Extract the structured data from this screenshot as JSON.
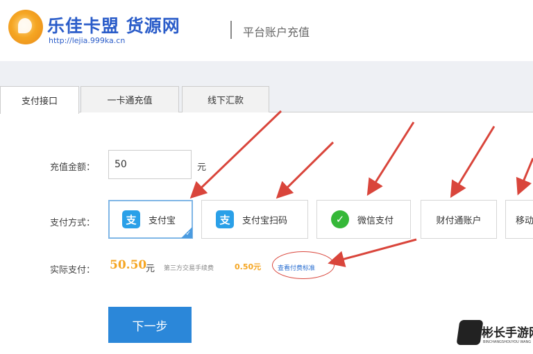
{
  "header": {
    "brand_title": "乐佳卡盟 货源网",
    "brand_url": "http://lejia.999ka.cn",
    "subtitle": "平台账户充值"
  },
  "tabs": [
    {
      "label": "支付接口",
      "active": true
    },
    {
      "label": "一卡通充值",
      "active": false
    },
    {
      "label": "线下汇款",
      "active": false
    }
  ],
  "form": {
    "amount_label": "充值金额：",
    "amount_value": "50",
    "amount_unit": "元",
    "method_label": "支付方式：",
    "payment_methods": [
      {
        "label": "支付宝",
        "icon": "alipay-icon",
        "selected": true
      },
      {
        "label": "支付宝扫码",
        "icon": "alipay-icon",
        "selected": false
      },
      {
        "label": "微信支付",
        "icon": "wechat-icon",
        "selected": false
      },
      {
        "label": "财付通账户",
        "icon": "",
        "selected": false
      },
      {
        "label": "移动",
        "icon": "",
        "selected": false
      }
    ],
    "actual_label": "实际支付：",
    "actual_amount": "50.50",
    "actual_unit": "元",
    "fee_note": "第三方交易手续费",
    "fee_amount": "0.50元",
    "detail_link": "查看付费标准",
    "next_button": "下一步"
  },
  "watermark": {
    "text": "彬长手游网",
    "subtext": "BINCHANGSHOUYOU WANG"
  },
  "colors": {
    "brand_blue": "#2a5cc9",
    "accent_orange": "#f5a623",
    "button_blue": "#2b87d9",
    "annotation_red": "#d9453b"
  }
}
